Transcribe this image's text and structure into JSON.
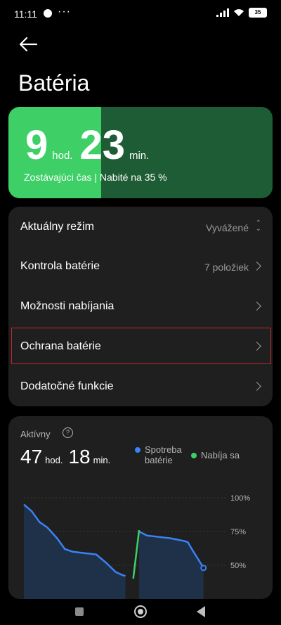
{
  "status_bar": {
    "time": "11:11",
    "dots": "···",
    "battery": "35"
  },
  "page": {
    "title": "Batéria"
  },
  "hero": {
    "hours": "9",
    "hours_unit": "hod.",
    "minutes": "23",
    "minutes_unit": "min.",
    "subtitle": "Zostávajúci čas | Nabité na 35 %",
    "fill_fraction": 0.35,
    "colors": {
      "fill": "#3ed067",
      "track": "#1d5c34"
    }
  },
  "settings": [
    {
      "label": "Aktuálny režim",
      "value": "Vyvážené"
    },
    {
      "label": "Kontrola batérie",
      "value": "7 položiek"
    },
    {
      "label": "Možnosti nabíjania",
      "value": ""
    },
    {
      "label": "Ochrana batérie",
      "value": ""
    },
    {
      "label": "Dodatočné funkcie",
      "value": ""
    }
  ],
  "usage": {
    "label": "Aktívny",
    "help": "?",
    "hours": "47",
    "hours_unit": "hod.",
    "minutes": "18",
    "minutes_unit": "min.",
    "legend": [
      {
        "line1": "Spotreba",
        "line2": "batérie",
        "color": "#3a82f7"
      },
      {
        "line1": "Nabíja sa",
        "line2": "",
        "color": "#3ed067"
      }
    ]
  },
  "chart_data": {
    "type": "line",
    "y_ticks": [
      "100%",
      "75%",
      "50%"
    ],
    "ylim": [
      40,
      100
    ],
    "xlim": [
      0,
      100
    ],
    "series": [
      {
        "name": "Spotreba batérie",
        "color": "#3a82f7",
        "points": [
          [
            0,
            95
          ],
          [
            4,
            90
          ],
          [
            8,
            82
          ],
          [
            12,
            78
          ],
          [
            17,
            70
          ],
          [
            21,
            62
          ],
          [
            25,
            60
          ],
          [
            31,
            59
          ],
          [
            37,
            58
          ],
          [
            42,
            52
          ],
          [
            47,
            45
          ],
          [
            50,
            43
          ],
          [
            52,
            42
          ]
        ]
      },
      {
        "name": "",
        "color": "#3a82f7",
        "points": [
          [
            59,
            75
          ],
          [
            63,
            72
          ],
          [
            69,
            71
          ],
          [
            75,
            70
          ],
          [
            82,
            68
          ],
          [
            84,
            67
          ],
          [
            86,
            62
          ],
          [
            89,
            55
          ],
          [
            92,
            48
          ]
        ]
      },
      {
        "name": "Nabíja sa",
        "color": "#3ed067",
        "points": [
          [
            56,
            40
          ],
          [
            59,
            76
          ]
        ]
      }
    ]
  }
}
